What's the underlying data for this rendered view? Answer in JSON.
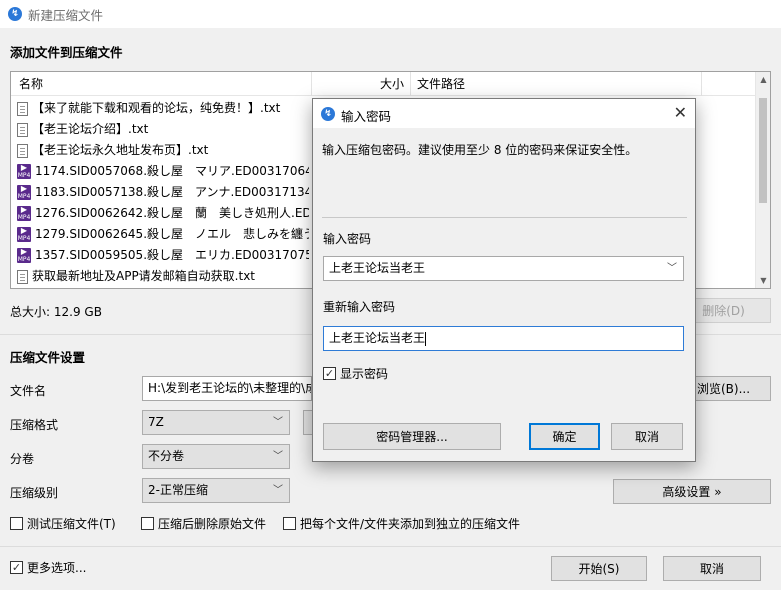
{
  "window": {
    "title": "新建压缩文件"
  },
  "header": {
    "section_title": "添加文件到压缩文件"
  },
  "file_list": {
    "columns": {
      "name": "名称",
      "size": "大小",
      "path": "文件路径"
    },
    "items": [
      {
        "name": "【来了就能下载和观看的论坛，纯免费！】.txt",
        "icon": "text-file-icon"
      },
      {
        "name": "【老王论坛介绍】.txt",
        "icon": "text-file-icon"
      },
      {
        "name": "【老王论坛永久地址发布页】.txt",
        "icon": "text-file-icon"
      },
      {
        "name": "1174.SID0057068.殺し屋　マリア.ED00317064.mp4",
        "icon": "video-file-icon"
      },
      {
        "name": "1183.SID0057138.殺し屋　アンナ.ED00317134.mp4",
        "icon": "video-file-icon"
      },
      {
        "name": "1276.SID0062642.殺し屋　蘭　美しき処刑人.ED.mp4",
        "icon": "video-file-icon"
      },
      {
        "name": "1279.SID0062645.殺し屋　ノエル　悲しみを纏う.mp4",
        "icon": "video-file-icon"
      },
      {
        "name": "1357.SID0059505.殺し屋　エリカ.ED00317075.mp4",
        "icon": "video-file-icon"
      },
      {
        "name": "获取最新地址及APP请发邮箱自动获取.txt",
        "icon": "text-file-icon"
      }
    ],
    "mp4_badge": "MP4"
  },
  "summary": {
    "total_size_label": "总大小: 12.9 GB",
    "delete_button": "删除(D)"
  },
  "settings": {
    "section_title": "压缩文件设置",
    "filename_label": "文件名",
    "filename_value": "H:\\发到老王论坛的\\未整理的\\成",
    "browse_button": "浏览(B)...",
    "format_label": "压缩格式",
    "format_value": "7Z",
    "split_label": "分卷",
    "split_value": "不分卷",
    "level_label": "压缩级别",
    "level_value": "2-正常压缩",
    "advanced_button": "高级设置 »",
    "test_checkbox": "测试压缩文件(T)",
    "delete_after_checkbox": "压缩后删除原始文件",
    "separate_checkbox": "把每个文件/文件夹添加到独立的压缩文件"
  },
  "footer": {
    "more_options": "更多选项...",
    "start_button": "开始(S)",
    "cancel_button": "取消"
  },
  "password_dialog": {
    "title": "输入密码",
    "description": "输入压缩包密码。建议使用至少 8 位的密码来保证安全性。",
    "password_label": "输入密码",
    "password_value": "上老王论坛当老王",
    "reenter_label": "重新输入密码",
    "reenter_value": "上老王论坛当老王",
    "show_password": "显示密码",
    "manager_button": "密码管理器...",
    "ok_button": "确定",
    "cancel_button": "取消"
  },
  "colors": {
    "accent": "#0078d7",
    "app_icon": "#2b78d8",
    "video_icon": "#5a2a8c"
  }
}
